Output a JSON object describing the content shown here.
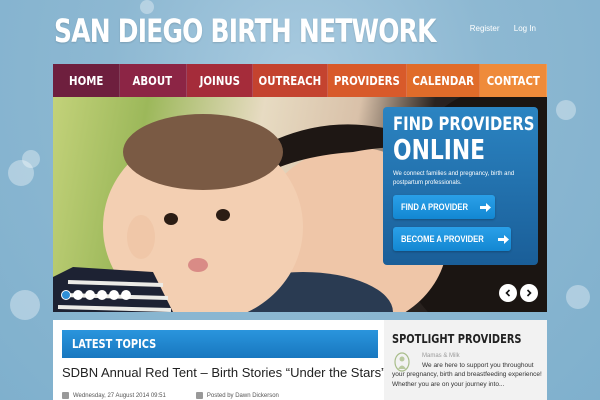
{
  "header": {
    "title": "SAN DIEGO BIRTH NETWORK"
  },
  "top_links": [
    "Register",
    "Log In"
  ],
  "nav": {
    "items": [
      {
        "label": "HOME",
        "color": "#6e1f3e"
      },
      {
        "label": "ABOUT",
        "color": "#8c2545"
      },
      {
        "label": "JOINUS",
        "color": "#a52c3a"
      },
      {
        "label": "OUTREACH",
        "color": "#c4432f"
      },
      {
        "label": "PROVIDERS",
        "color": "#d85a2a"
      },
      {
        "label": "CALENDAR",
        "color": "#e06c2a"
      },
      {
        "label": "CONTACT",
        "color": "#ef8b3a"
      }
    ]
  },
  "hero": {
    "title_line1": "FIND PROVIDERS",
    "title_line2": "ONLINE",
    "text": "We connect families and pregnancy, birth and postpartum professionals.",
    "buttons": [
      "FIND A PROVIDER",
      "BECOME A PROVIDER"
    ],
    "dot_count": 6,
    "active_dot": 0,
    "prev_icon": "chevron-left-icon",
    "next_icon": "chevron-right-icon"
  },
  "topics": {
    "header": "LATEST TOPICS",
    "post_title": "SDBN Annual Red Tent – Birth Stories “Under the Stars”",
    "date": "Wednesday, 27 August 2014 09:51",
    "author": "Posted by Dawn Dickerson"
  },
  "spotlight": {
    "header": "SPOTLIGHT PROVIDERS",
    "name": "Mamas & Milk",
    "text": "We are here to support you throughout your pregnancy, birth and breastfeeding experience! Whether you are on your journey into..."
  }
}
